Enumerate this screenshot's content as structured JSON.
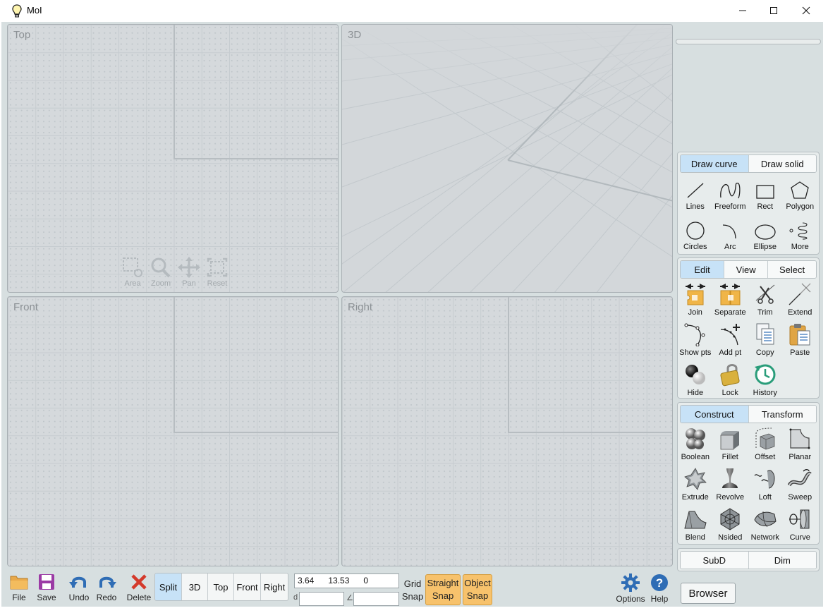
{
  "window": {
    "title": "MoI"
  },
  "viewports": {
    "top": {
      "label": "Top"
    },
    "three_d": {
      "label": "3D"
    },
    "front": {
      "label": "Front"
    },
    "right": {
      "label": "Right"
    },
    "nav_tools": [
      {
        "label": "Area",
        "icon": "area-zoom-icon"
      },
      {
        "label": "Zoom",
        "icon": "magnifier-icon"
      },
      {
        "label": "Pan",
        "icon": "pan-arrows-icon"
      },
      {
        "label": "Reset",
        "icon": "reset-view-icon"
      }
    ]
  },
  "bottom_toolbar": {
    "file": "File",
    "save": "Save",
    "undo": "Undo",
    "redo": "Redo",
    "delete": "Delete",
    "views": [
      "Split",
      "3D",
      "Top",
      "Front",
      "Right"
    ],
    "active_view": "Split",
    "coords": {
      "x": "3.64",
      "y": "13.53",
      "z": "0"
    },
    "distance_label": "d",
    "angle_label": "∠",
    "grid_snap": [
      "Grid",
      "Snap"
    ],
    "straight_snap": [
      "Straight",
      "Snap"
    ],
    "object_snap": [
      "Object",
      "Snap"
    ],
    "options": "Options",
    "help": "Help"
  },
  "draw_panel": {
    "tabs": [
      "Draw curve",
      "Draw solid"
    ],
    "active_tab": "Draw curve",
    "tools": [
      {
        "label": "Lines",
        "icon": "line-icon"
      },
      {
        "label": "Freeform",
        "icon": "freeform-curve-icon"
      },
      {
        "label": "Rect",
        "icon": "rectangle-icon"
      },
      {
        "label": "Polygon",
        "icon": "polygon-icon"
      },
      {
        "label": "Circles",
        "icon": "circle-icon"
      },
      {
        "label": "Arc",
        "icon": "arc-icon"
      },
      {
        "label": "Ellipse",
        "icon": "ellipse-icon"
      },
      {
        "label": "More",
        "icon": "more-curves-icon"
      }
    ]
  },
  "edit_panel": {
    "tabs": [
      "Edit",
      "View",
      "Select"
    ],
    "active_tab": "Edit",
    "tools": [
      {
        "label": "Join",
        "icon": "join-icon"
      },
      {
        "label": "Separate",
        "icon": "separate-icon"
      },
      {
        "label": "Trim",
        "icon": "scissors-icon"
      },
      {
        "label": "Extend",
        "icon": "extend-icon"
      },
      {
        "label": "Show pts",
        "icon": "show-points-icon"
      },
      {
        "label": "Add pt",
        "icon": "add-point-icon"
      },
      {
        "label": "Copy",
        "icon": "copy-icon"
      },
      {
        "label": "Paste",
        "icon": "paste-icon"
      },
      {
        "label": "Hide",
        "icon": "hide-icon"
      },
      {
        "label": "Lock",
        "icon": "lock-icon"
      },
      {
        "label": "History",
        "icon": "history-icon"
      }
    ]
  },
  "construct_panel": {
    "tabs": [
      "Construct",
      "Transform"
    ],
    "active_tab": "Construct",
    "tools": [
      {
        "label": "Boolean",
        "icon": "boolean-icon"
      },
      {
        "label": "Fillet",
        "icon": "fillet-icon"
      },
      {
        "label": "Offset",
        "icon": "offset-icon"
      },
      {
        "label": "Planar",
        "icon": "planar-icon"
      },
      {
        "label": "Extrude",
        "icon": "extrude-icon"
      },
      {
        "label": "Revolve",
        "icon": "revolve-icon"
      },
      {
        "label": "Loft",
        "icon": "loft-icon"
      },
      {
        "label": "Sweep",
        "icon": "sweep-icon"
      },
      {
        "label": "Blend",
        "icon": "blend-icon"
      },
      {
        "label": "Nsided",
        "icon": "nsided-icon"
      },
      {
        "label": "Network",
        "icon": "network-icon"
      },
      {
        "label": "Curve",
        "icon": "curve-icon"
      }
    ]
  },
  "subd_panel": {
    "tabs": [
      "SubD",
      "Dim"
    ]
  },
  "browser": "Browser"
}
